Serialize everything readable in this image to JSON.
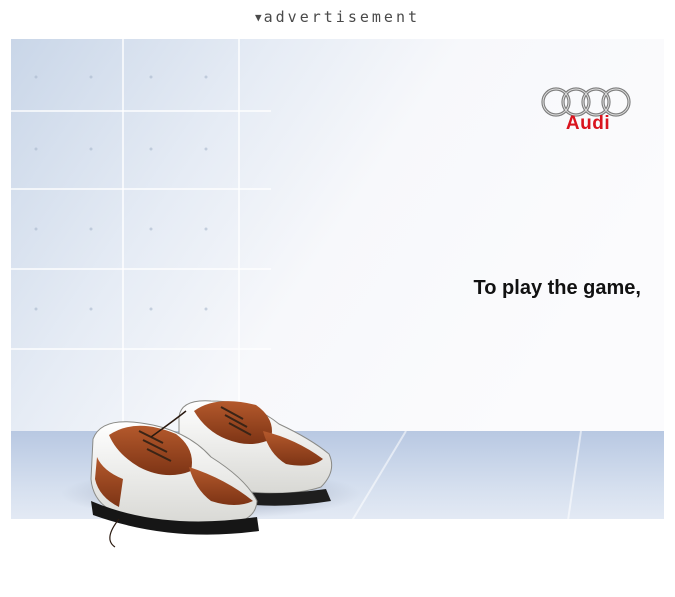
{
  "header": {
    "label": "advertisement",
    "toggle_glyph": "▼"
  },
  "ad": {
    "brand": "Audi",
    "brand_color": "#d9141e",
    "tagline": "To play the game,",
    "logo_icon": "four-rings-icon",
    "image_subject": "golf-shoes-image"
  }
}
